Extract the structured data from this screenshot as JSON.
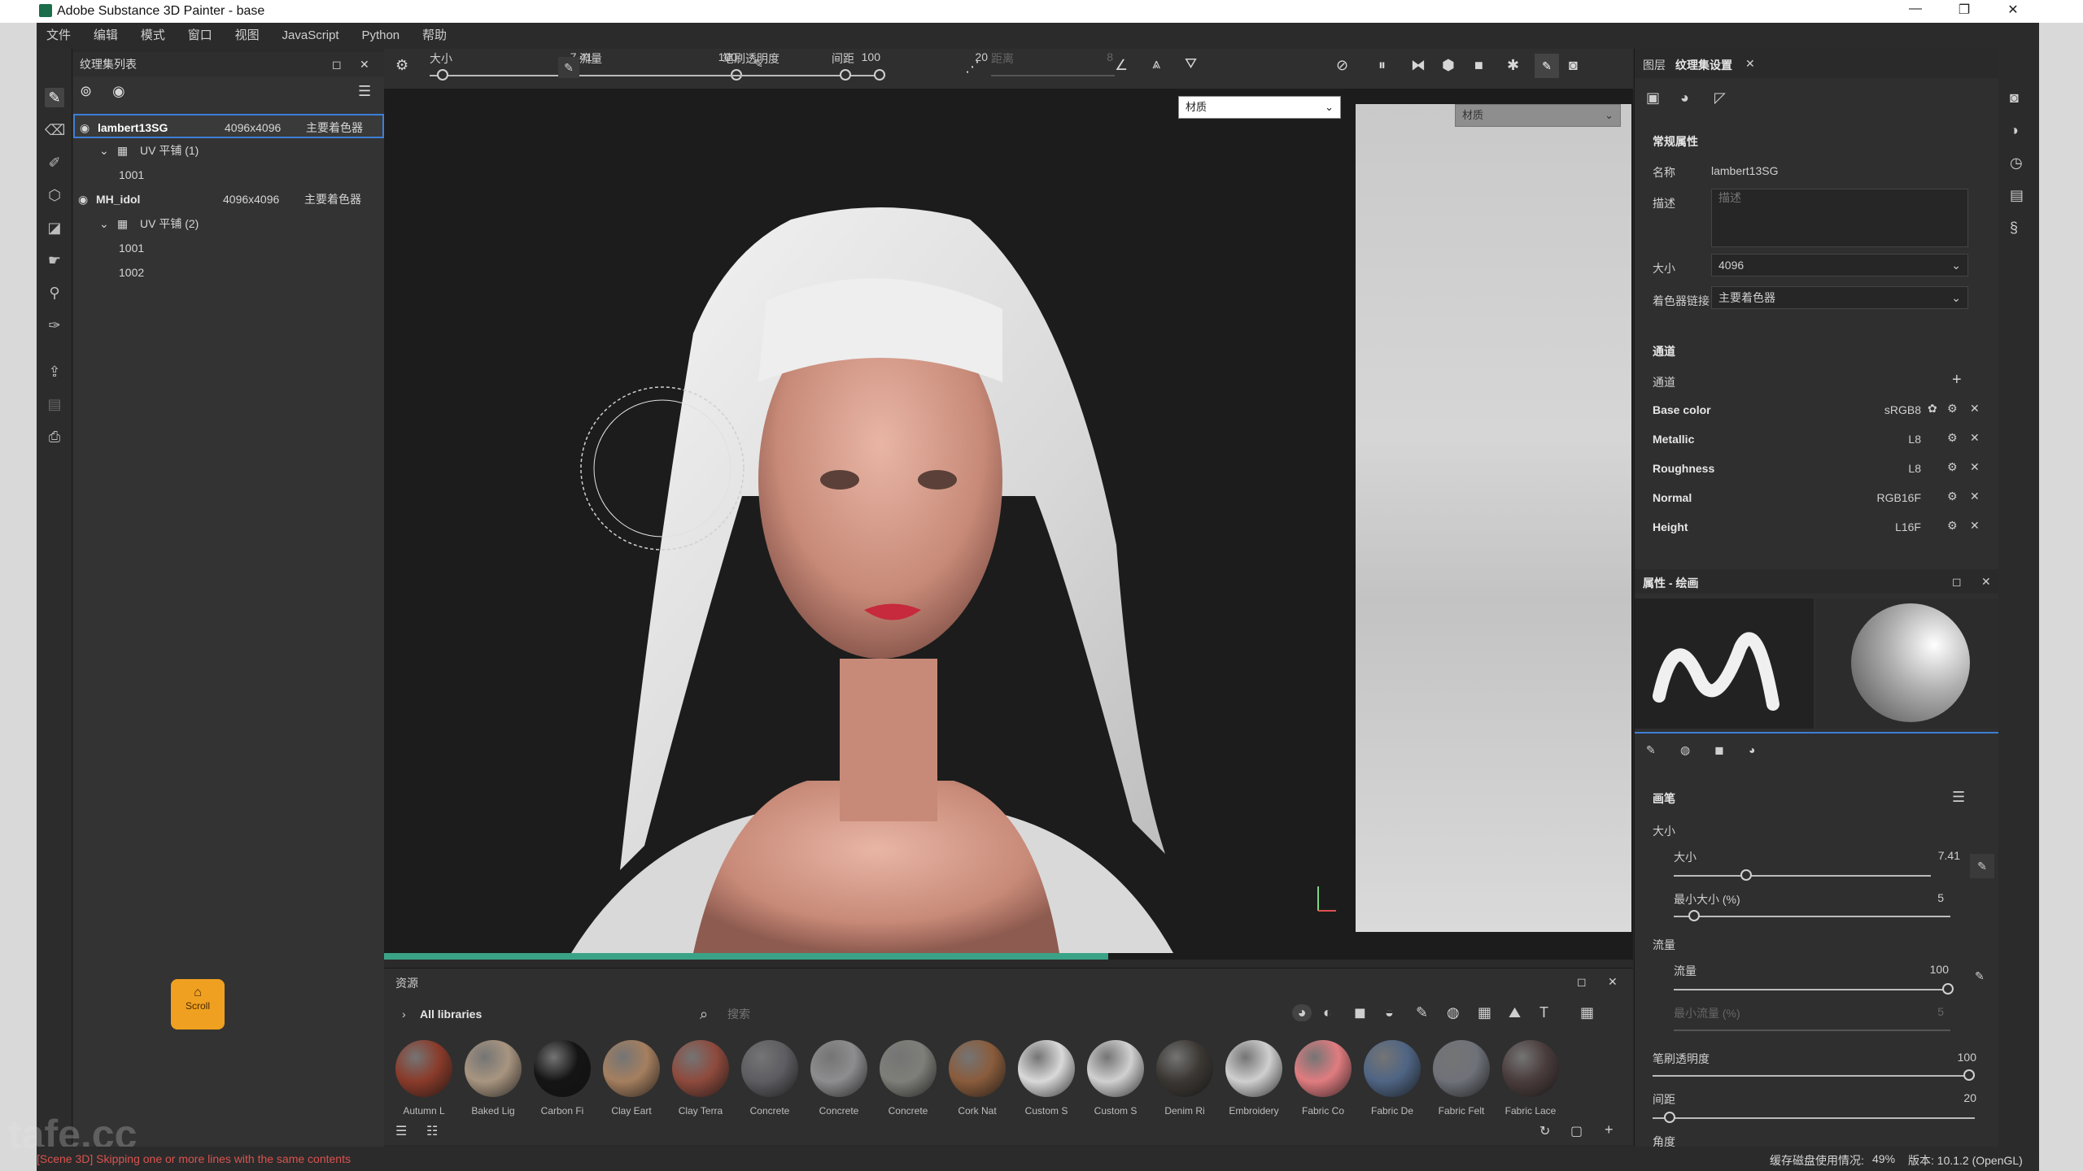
{
  "app": {
    "title": "Adobe Substance 3D Painter - base"
  },
  "window_controls": {
    "minimize": "—",
    "restore": "❐",
    "close": "✕"
  },
  "menu": [
    "文件",
    "编辑",
    "模式",
    "窗口",
    "视图",
    "JavaScript",
    "Python",
    "帮助"
  ],
  "texture_set_list": {
    "title": "纹理集列表",
    "sets": [
      {
        "name": "lambert13SG",
        "size": "4096x4096",
        "shader": "主要着色器",
        "uv_label": "UV 平铺 (1)",
        "tiles": [
          "1001"
        ]
      },
      {
        "name": "MH_idol",
        "size": "4096x4096",
        "shader": "主要着色器",
        "uv_label": "UV 平铺 (2)",
        "tiles": [
          "1001",
          "1002"
        ]
      }
    ]
  },
  "toolbar": {
    "size_label": "大小",
    "size_value": "7.41",
    "flow_label": "流量",
    "flow_value": "100",
    "opacity_label": "笔刷透明度",
    "opacity_value": "100",
    "spacing_label": "间距",
    "spacing_value": "20",
    "jitter_label": "距离",
    "jitter_value": "8",
    "slider_levels": {
      "size": 0.05,
      "flow": 1.0,
      "opacity": 1.0,
      "spacing": 0.02
    }
  },
  "viewport": {
    "material_select": "材质",
    "uv_material_select": "材质"
  },
  "texture_set_settings": {
    "tabs": [
      "图层",
      "纹理集设置"
    ],
    "section_general": "常规属性",
    "name_label": "名称",
    "name_value": "lambert13SG",
    "desc_label": "描述",
    "desc_placeholder": "描述",
    "size_label": "大小",
    "size_value": "4096",
    "shader_label": "着色器链接",
    "shader_value": "主要着色器",
    "channels_section": "通道",
    "channels_label": "通道",
    "channels": [
      {
        "name": "Base color",
        "format": "sRGB8"
      },
      {
        "name": "Metallic",
        "format": "L8"
      },
      {
        "name": "Roughness",
        "format": "L8"
      },
      {
        "name": "Normal",
        "format": "RGB16F"
      },
      {
        "name": "Height",
        "format": "L16F"
      }
    ]
  },
  "paint_properties": {
    "title": "属性 - 绘画",
    "section_brush": "画笔",
    "size_group": "大小",
    "size_label": "大小",
    "size_value": "7.41",
    "min_size_label": "最小大小 (%)",
    "min_size_value": "5",
    "flow_group": "流量",
    "flow_label": "流量",
    "flow_value": "100",
    "min_flow_label": "最小流量 (%)",
    "min_flow_value": "5",
    "opacity_label": "笔刷透明度",
    "opacity_value": "100",
    "spacing_label": "间距",
    "spacing_value": "20",
    "angle_label": "角度",
    "levels": {
      "size": 0.05,
      "min_size": 0.05,
      "flow": 1.0,
      "min_flow": 0.05,
      "opacity": 1.0,
      "spacing": 0.02
    }
  },
  "assets": {
    "title": "资源",
    "library": "All libraries",
    "search_placeholder": "搜索",
    "materials": [
      {
        "label": "Autumn L",
        "color": "#8a3b2a"
      },
      {
        "label": "Baked Lig",
        "color": "#a89580"
      },
      {
        "label": "Carbon Fi",
        "color": "#141414"
      },
      {
        "label": "Clay Eart",
        "color": "#a57f5f"
      },
      {
        "label": "Clay Terra",
        "color": "#8e4a3d"
      },
      {
        "label": "Concrete",
        "color": "#5d5d62"
      },
      {
        "label": "Concrete",
        "color": "#8d8d8f"
      },
      {
        "label": "Concrete",
        "color": "#7e7f79"
      },
      {
        "label": "Cork Nat",
        "color": "#8a5c3c"
      },
      {
        "label": "Custom S",
        "color": "#d9d9d9"
      },
      {
        "label": "Custom S",
        "color": "#d0d0d0"
      },
      {
        "label": "Denim Ri",
        "color": "#3b3733"
      },
      {
        "label": "Embroidery",
        "color": "#cfcfcf"
      },
      {
        "label": "Fabric Co",
        "color": "#e07c80"
      },
      {
        "label": "Fabric De",
        "color": "#4f6584"
      },
      {
        "label": "Fabric Felt",
        "color": "#6f7279"
      },
      {
        "label": "Fabric Lace",
        "color": "#4a3c3c"
      }
    ],
    "progress": 0.58
  },
  "scroll_widget": {
    "label": "Scroll"
  },
  "status": {
    "message": "[Scene 3D] Skipping one or more lines with the same contents",
    "cache_label": "缓存磁盘使用情况:",
    "cache_value": "49%",
    "version": "版本: 10.1.2 (OpenGL)"
  },
  "watermark": "tafe.cc",
  "colors": {
    "accent": "#3d7fd6",
    "progress": "#3aa387",
    "status_error": "#d9534f",
    "scroll_orange": "#f0a020"
  }
}
